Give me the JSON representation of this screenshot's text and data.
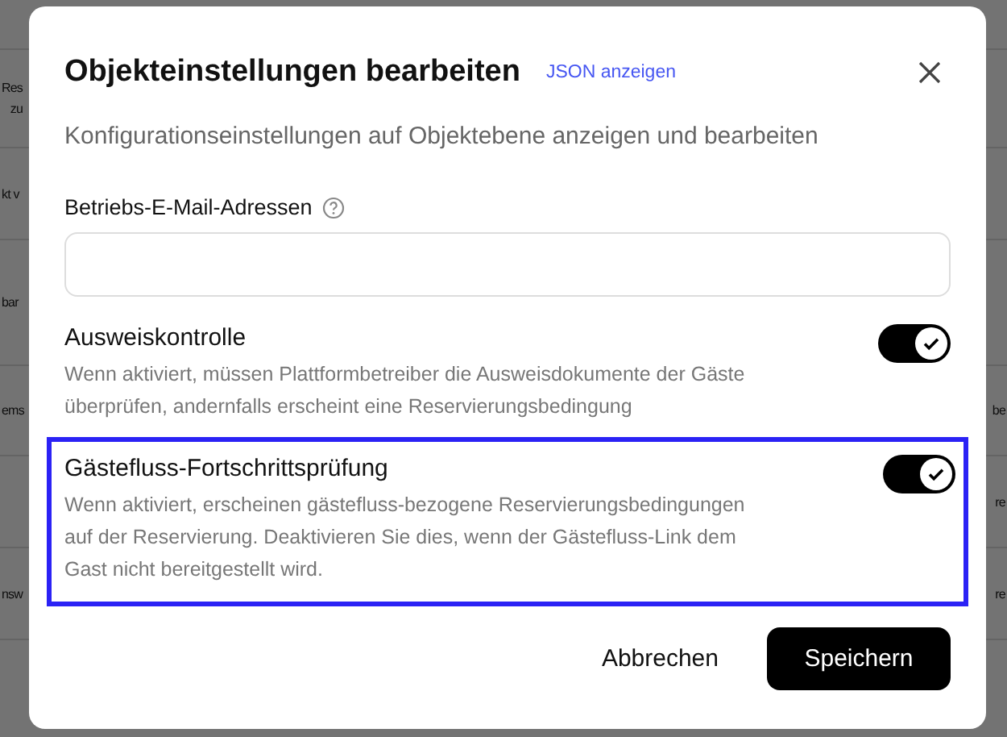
{
  "background_rows": [
    {
      "column_1": "",
      "column_2": ""
    },
    {
      "column_1": "Res\nzu",
      "column_2": ""
    },
    {
      "column_1": "kt v",
      "column_2": ""
    },
    {
      "column_1": "bar",
      "column_2": ""
    },
    {
      "column_1": "ems",
      "column_2": "be"
    },
    {
      "column_1": "",
      "column_2": "re"
    },
    {
      "column_1": "nsw",
      "column_2": "re"
    }
  ],
  "dialog": {
    "title": "Objekteinstellungen bearbeiten",
    "link": "JSON anzeigen",
    "subtitle": "Konfigurationseinstellungen auf Objektebene anzeigen und bearbeiten",
    "email_field": {
      "label": "Betriebs-E-Mail-Adressen"
    },
    "settings": [
      {
        "title": "Ausweiskontrolle",
        "description": "Wenn aktiviert, müssen Plattformbetreiber die Ausweisdokumente der Gäste überprüfen, andernfalls erscheint eine Reservierungsbedingung",
        "on": true,
        "highlighted": false
      },
      {
        "title": "Gästefluss-Fortschrittsprüfung",
        "description": "Wenn aktiviert, erscheinen gästefluss-bezogene Reservierungsbedingungen auf der Reservierung. Deaktivieren Sie dies, wenn der Gästefluss-Link dem Gast nicht bereitgestellt wird.",
        "on": true,
        "highlighted": true
      }
    ],
    "buttons": [
      {
        "label": "Abbrechen",
        "kind": "secondary"
      },
      {
        "label": "Speichern",
        "kind": "primary"
      }
    ]
  }
}
